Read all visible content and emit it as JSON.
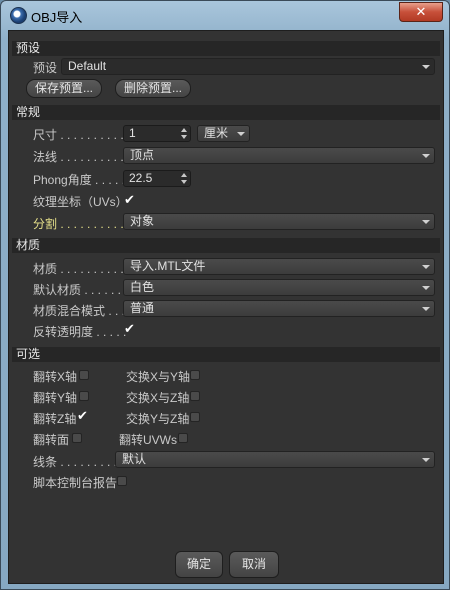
{
  "window": {
    "title": "OBJ导入",
    "close_glyph": "✕"
  },
  "sections": {
    "presets": "预设",
    "general": "常规",
    "material": "材质",
    "optional": "可选"
  },
  "presets": {
    "preset_label": "预设",
    "preset_value": "Default",
    "save_button": "保存预置...",
    "delete_button": "删除预置..."
  },
  "general": {
    "size_label": "尺寸 . . . . . . . . . . .",
    "size_value": "1",
    "unit_value": "厘米",
    "normals_label": "法线 . . . . . . . . . . .",
    "normals_value": "顶点",
    "phong_label": "Phong角度 . . . . .",
    "phong_value": "22.5",
    "uv_label": "纹理坐标（UVs）",
    "uv_checked": true,
    "split_label": "分割 . . . . . . . . . . .",
    "split_value": "对象"
  },
  "material": {
    "material_label": "材质 . . . . . . . . . . .",
    "material_value": "导入.MTL文件",
    "default_material_label": "默认材质 . . . . . . .",
    "default_material_value": "白色",
    "blend_mode_label": "材质混合模式 . . .",
    "blend_mode_value": "普通",
    "invert_transparency_label": "反转透明度 . . . . .",
    "invert_transparency_checked": true
  },
  "optional": {
    "flip_x": "翻转X轴",
    "flip_x_checked": false,
    "flip_y": "翻转Y轴",
    "flip_y_checked": false,
    "flip_z": "翻转Z轴",
    "flip_z_checked": true,
    "swap_xy": "交换X与Y轴",
    "swap_xy_checked": false,
    "swap_xz": "交换X与Z轴",
    "swap_xz_checked": false,
    "swap_yz": "交换Y与Z轴",
    "swap_yz_checked": false,
    "flip_faces": "翻转面",
    "flip_faces_checked": false,
    "flip_uvws": "翻转UVWs",
    "flip_uvws_checked": false,
    "lines_label": "线条 . . . . . . . . . . .",
    "lines_value": "默认",
    "script_console": "脚本控制台报告",
    "script_console_checked": false
  },
  "footer": {
    "ok": "确定",
    "cancel": "取消"
  },
  "colors": {
    "panel_bg": "#333333",
    "section_bg": "#262626",
    "highlight_label": "#e6e08a"
  }
}
